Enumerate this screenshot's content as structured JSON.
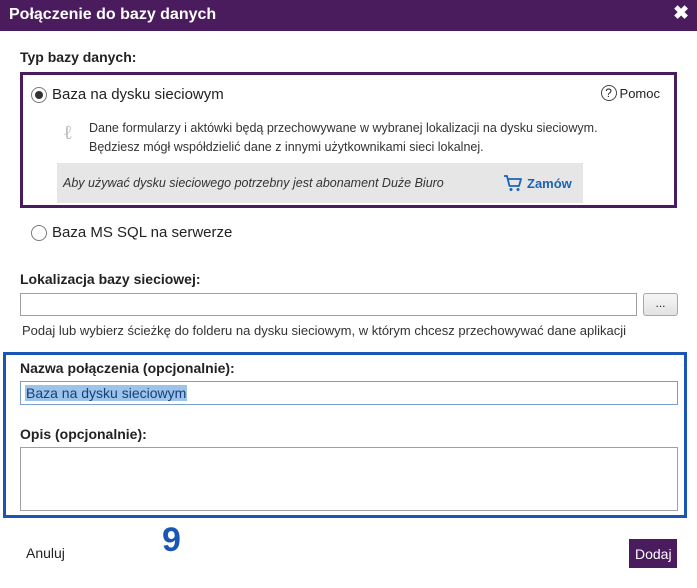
{
  "dialog": {
    "title": "Połączenie do bazy danych",
    "close_symbol": "✖"
  },
  "db_type": {
    "label": "Typ bazy danych:",
    "options": [
      {
        "label": "Baza na dysku sieciowym",
        "selected": true
      },
      {
        "label": "Baza MS SQL na serwerze",
        "selected": false
      }
    ],
    "help_label": "Pomoc",
    "info_lines": [
      "Dane formularzy i aktówki będą przechowywane w wybranej lokalizacji na dysku sieciowym.",
      "Będziesz mógł współdzielić dane z innymi użytkownikami sieci lokalnej."
    ],
    "notice": "Aby używać dysku sieciowego potrzebny jest abonament Duże Biuro",
    "order_label": "Zamów"
  },
  "location": {
    "label": "Lokalizacja bazy sieciowej:",
    "value": "",
    "browse_label": "...",
    "hint": "Podaj lub wybierz ścieżkę do folderu na dysku sieciowym, w którym chcesz przechowywać dane aplikacji"
  },
  "connection_name": {
    "label": "Nazwa połączenia (opcjonalnie):",
    "value": "Baza na dysku sieciowym"
  },
  "description": {
    "label": "Opis (opcjonalnie):",
    "value": ""
  },
  "step_number": "9",
  "footer": {
    "cancel_label": "Anuluj",
    "add_label": "Dodaj"
  },
  "colors": {
    "accent": "#4a1c5e",
    "highlight": "#1a56b5",
    "link": "#1b63b8"
  },
  "icons": [
    "close-icon",
    "radio-checked-icon",
    "radio-unchecked-icon",
    "help-icon",
    "info-icon",
    "cart-icon"
  ]
}
